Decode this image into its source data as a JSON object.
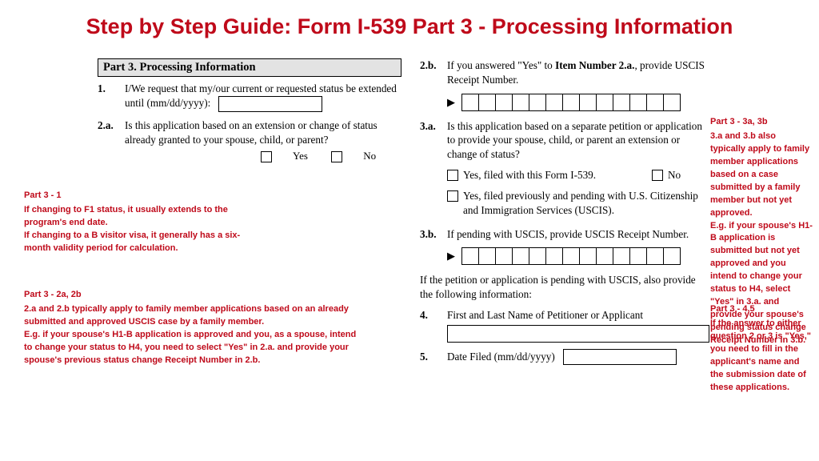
{
  "title": "Step by Step Guide: Form I-539 Part 3 - Processing Information",
  "form": {
    "part_heading": "Part 3.  Processing Information",
    "q1": {
      "num": "1.",
      "text_a": "I/We request that my/our current or requested status be extended until (mm/dd/yyyy):"
    },
    "q2a": {
      "num": "2.a.",
      "text": "Is this application based on an extension or change of status already granted to your spouse, child, or parent?",
      "yes": "Yes",
      "no": "No"
    },
    "q2b": {
      "num": "2.b.",
      "text_pre": "If you answered \"Yes\" to ",
      "bold": "Item Number 2.a.",
      "text_post": ", provide USCIS Receipt Number."
    },
    "q3a": {
      "num": "3.a.",
      "text": "Is this application based on a separate petition or application to provide your spouse, child, or parent an extension or change of status?",
      "opt1": "Yes, filed with this Form I-539.",
      "no": "No",
      "opt2": "Yes, filed previously and pending with U.S. Citizenship and Immigration Services (USCIS)."
    },
    "q3b": {
      "num": "3.b.",
      "text": "If pending with USCIS, provide USCIS Receipt Number."
    },
    "pending_intro": "If the petition or application is pending with USCIS, also provide the following information:",
    "q4": {
      "num": "4.",
      "text": "First and Last Name of Petitioner or Applicant"
    },
    "q5": {
      "num": "5.",
      "text": "Date Filed (mm/dd/yyyy)"
    }
  },
  "notes": {
    "n1": {
      "hd": "Part 3 - 1",
      "body": "If changing to F1 status, it usually extends to the program's end date.\nIf changing to a B visitor visa, it generally has a six-month validity period for calculation."
    },
    "n2": {
      "hd": "Part 3 - 2a, 2b",
      "body": "2.a and 2.b typically apply to family member applications based on an already submitted and approved USCIS case by a family member.\nE.g. if your spouse's H1-B application is approved and you, as a spouse, intend to change your status to H4, you need to select \"Yes\" in 2.a. and provide your spouse's previous status change Receipt Number in 2.b."
    },
    "n3": {
      "hd": "Part 3 - 3a, 3b",
      "body": "3.a and 3.b also typically apply to family member applications based on a case submitted by a family member but not yet approved.\nE.g. if your spouse's H1-B application is submitted but not yet approved and you intend to change your status to H4, select \"Yes\" in 3.a. and provide your spouse's pending status change Receipt Number in 3.b."
    },
    "n4": {
      "hd": "Part 3 - 4,5",
      "body": "If the answer to either question 2 or 3 is \"Yes,\" you need to fill in the applicant's name and the submission date of these applications."
    }
  }
}
